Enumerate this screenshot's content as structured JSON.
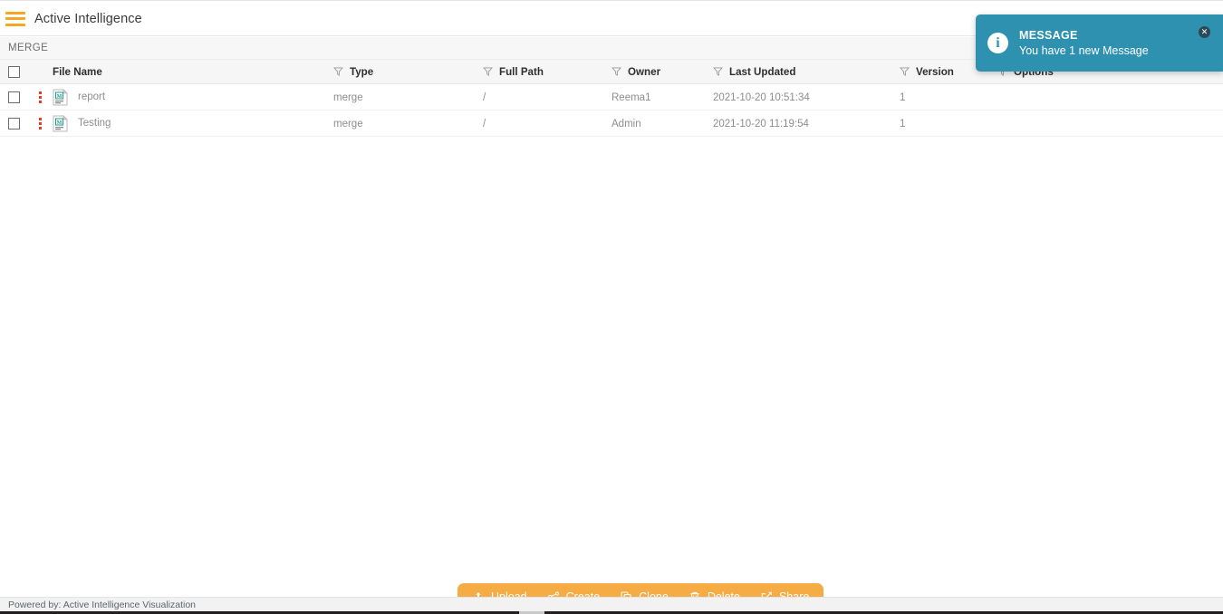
{
  "appbar": {
    "menu_icon": "hamburger-icon",
    "title": "Active Intelligence"
  },
  "module": {
    "label": "MERGE"
  },
  "table": {
    "columns": [
      {
        "label": "File Name",
        "filter_icon": "funnel-icon"
      },
      {
        "label": "Type",
        "filter_icon": "funnel-icon"
      },
      {
        "label": "Full Path",
        "filter_icon": "funnel-icon"
      },
      {
        "label": "Owner",
        "filter_icon": "funnel-icon"
      },
      {
        "label": "Last Updated",
        "filter_icon": "funnel-icon"
      },
      {
        "label": "Version",
        "filter_icon": "funnel-icon"
      },
      {
        "label": "Options",
        "filter_icon": "funnel-icon"
      }
    ],
    "rows": [
      {
        "file_name": "report",
        "type": "merge",
        "full_path": "/",
        "owner": "Reema1",
        "last_updated": "2021-10-20 10:51:34",
        "version": "1",
        "file_icon": "merge-file-icon"
      },
      {
        "file_name": "Testing",
        "type": "merge",
        "full_path": "/",
        "owner": "Admin",
        "last_updated": "2021-10-20 11:19:54",
        "version": "1",
        "file_icon": "merge-file-icon"
      }
    ]
  },
  "actionbar": {
    "actions": [
      {
        "label": "Upload",
        "icon": "upload-icon"
      },
      {
        "label": "Create",
        "icon": "branch-icon"
      },
      {
        "label": "Clone",
        "icon": "copy-icon"
      },
      {
        "label": "Delete",
        "icon": "trash-icon"
      },
      {
        "label": "Share",
        "icon": "share-icon"
      }
    ]
  },
  "toast": {
    "title": "MESSAGE",
    "message": "You have 1 new Message",
    "icon": "info-icon",
    "close_icon": "close-icon",
    "close_label": "✕"
  },
  "footer": {
    "text": "Powered by: Active Intelligence Visualization"
  },
  "colors": {
    "accent_orange": "#f5a623",
    "toolbar_orange": "#f5ac45",
    "toast_teal": "#2e91b0",
    "kebab_red": "#e23b2e",
    "header_gray": "#f6f6f6"
  }
}
